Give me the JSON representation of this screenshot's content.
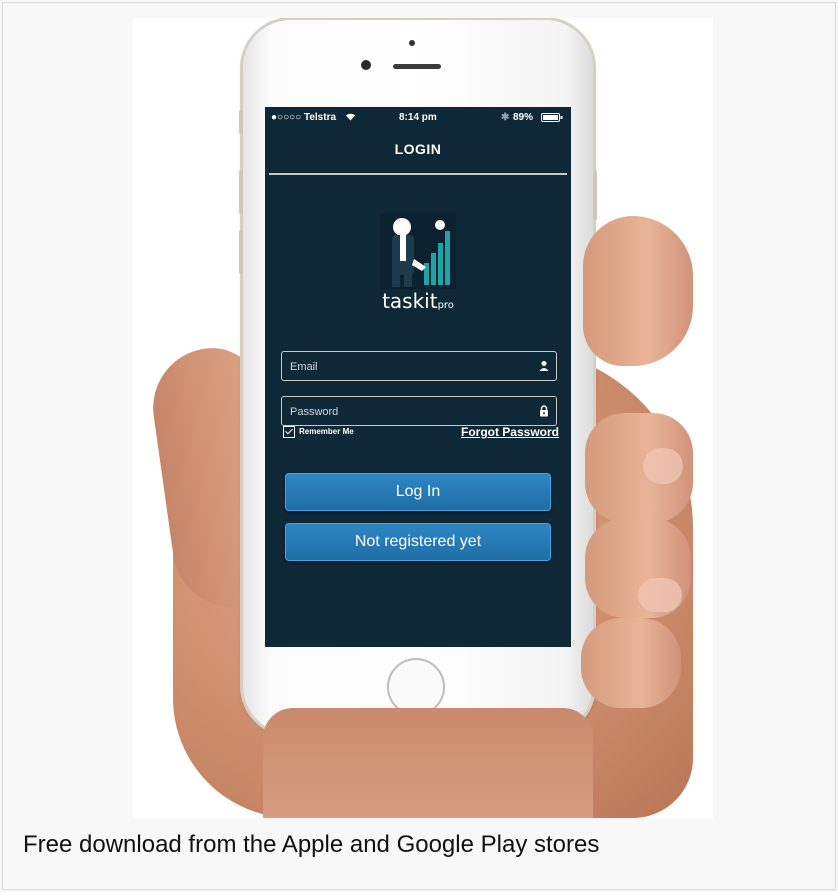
{
  "caption": "Free download from the Apple and Google Play stores",
  "phone": {
    "status": {
      "carrier": "●○○○○ Telstra",
      "time": "8:14 pm",
      "battery": "89%",
      "icons": [
        "wifi-icon",
        "bluetooth-icon",
        "battery-icon"
      ]
    },
    "nav_title": "LOGIN",
    "logo": {
      "name": "taskit",
      "suffix": "pro",
      "icon": "businessman-chart-icon"
    },
    "email": {
      "placeholder": "Email",
      "value": "",
      "icon": "user-icon"
    },
    "password": {
      "placeholder": "Password",
      "value": "",
      "icon": "lock-icon"
    },
    "remember_me": {
      "label": "Remember Me",
      "checked": true
    },
    "forgot_password": "Forgot Password",
    "login_button": "Log In",
    "register_button": "Not registered yet"
  },
  "colors": {
    "screen_bg": "#0f2838",
    "button_blue": "#2179b6",
    "logo_teal": "#1fa3a6"
  }
}
